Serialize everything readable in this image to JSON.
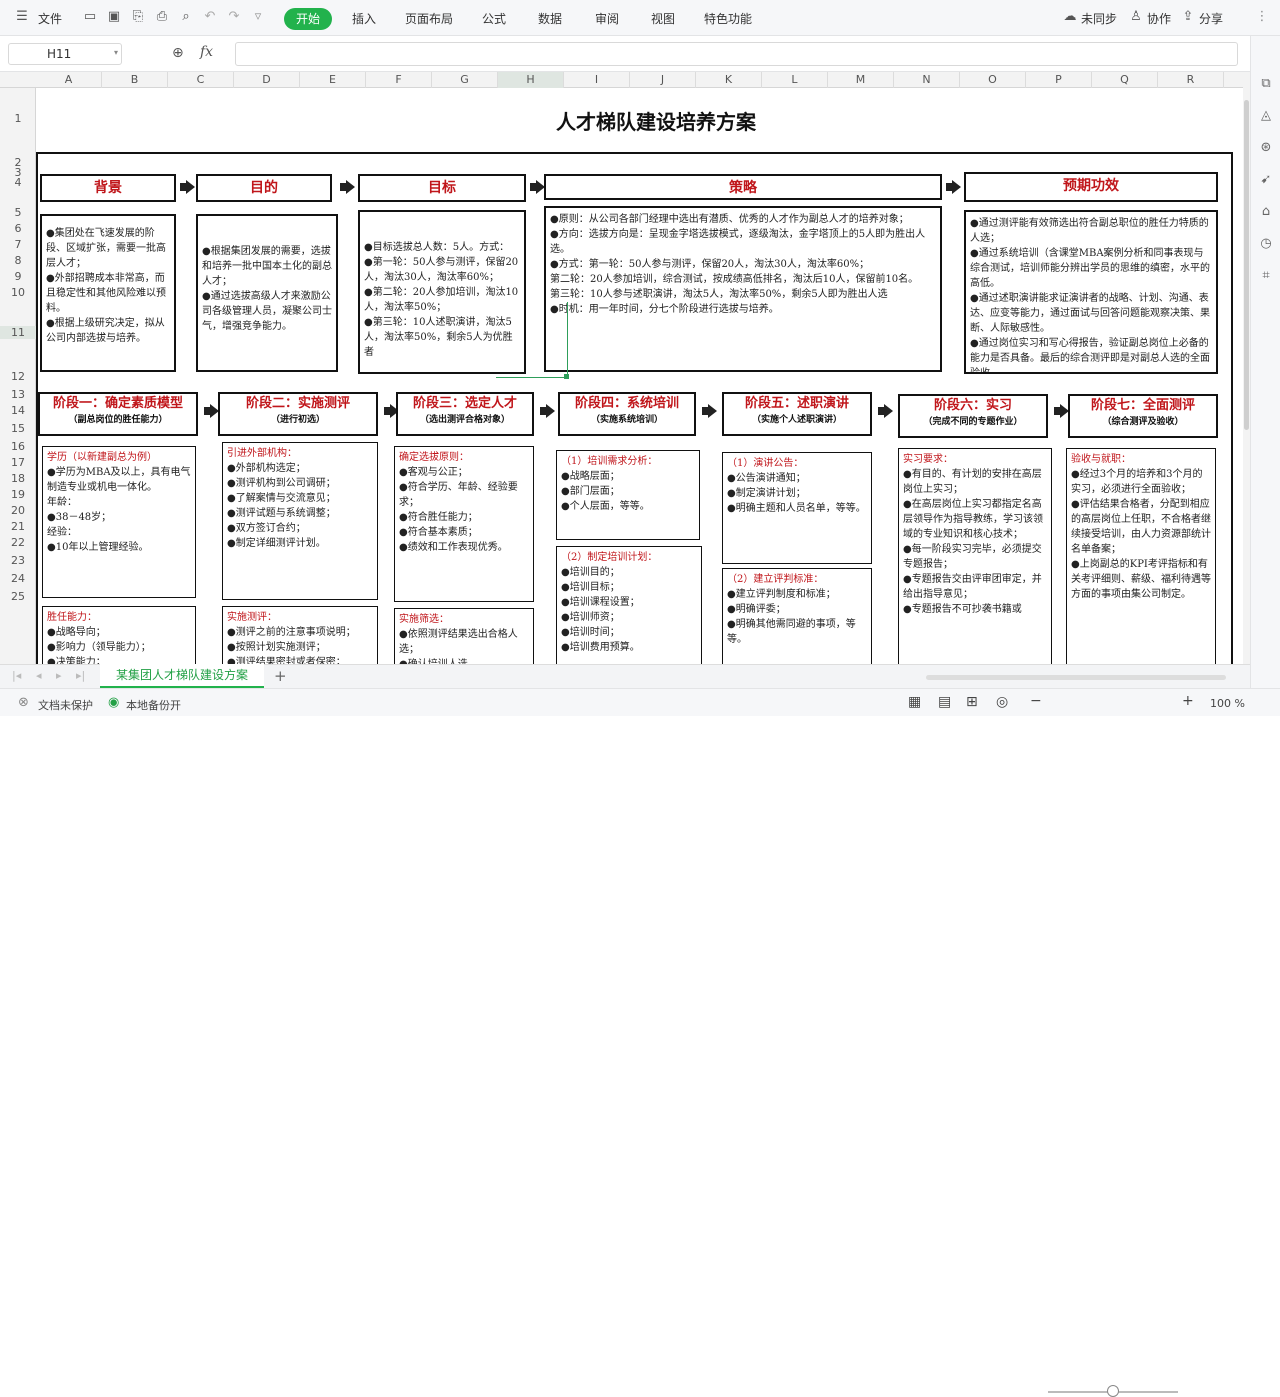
{
  "menu": {
    "file": "文件",
    "tabs": [
      "开始",
      "插入",
      "页面布局",
      "公式",
      "数据",
      "审阅",
      "视图",
      "特色功能"
    ],
    "sync": "未同步",
    "collab": "协作",
    "share": "分享"
  },
  "formula": {
    "cell": "H11",
    "fx": "fx",
    "content": ""
  },
  "columns": [
    "A",
    "B",
    "C",
    "D",
    "E",
    "F",
    "G",
    "H",
    "I",
    "J",
    "K",
    "L",
    "M",
    "N",
    "O",
    "P",
    "Q",
    "R"
  ],
  "rows": [
    "1",
    "2",
    "3",
    "4",
    "5",
    "6",
    "7",
    "8",
    "9",
    "10",
    "11",
    "12",
    "13",
    "14",
    "15",
    "16",
    "17",
    "18",
    "19",
    "20",
    "21",
    "22",
    "23",
    "24",
    "25"
  ],
  "doc": {
    "title": "人才梯队建设培养方案",
    "headers": [
      "背景",
      "目的",
      "目标",
      "策略",
      "预期功效"
    ],
    "bg": "●集团处在飞速发展的阶段、区域扩张，需要一批高层人才；\n●外部招聘成本非常高，而且稳定性和其他风险难以预料。\n●根据上级研究决定，拟从公司内部选拔与培养。",
    "purpose": "●根据集团发展的需要，选拔和培养一批中国本土化的副总人才；\n●通过选拔高级人才来激励公司各级管理人员，凝聚公司士气，增强竞争能力。",
    "goal": "●目标选拔总人数：5人。方式：\n●第一轮：50人参与测评，保留20人，淘汰30人，淘汰率60%；\n●第二轮：20人参加培训，淘汰10人，淘汰率50%；\n●第三轮：10人述职演讲，淘汰5人，淘汰率50%，剩余5人为优胜者",
    "strategy": "●原则：从公司各部门经理中选出有潜质、优秀的人才作为副总人才的培养对象；\n●方向：选拔方向是：呈现金字塔选拔模式，逐级淘汰，金字塔顶上的5人即为胜出人选。\n●方式：第一轮：50人参与测评，保留20人，淘汰30人，淘汰率60%；\n    第二轮：20人参加培训，综合测试，按成绩高低排名，淘汰后10人，保留前10名。\n    第三轮：10人参与述职演讲，淘汰5人，淘汰率50%，剩余5人即为胜出人选\n●时机：用一年时间，分七个阶段进行选拔与培养。",
    "effect": "●通过测评能有效筛选出符合副总职位的胜任力特质的人选；\n●通过系统培训（含课堂MBA案例分析和同事表现与综合测试，培训师能分辨出学员的思维的缜密，水平的高低。\n●通过述职演讲能求证演讲者的战略、计划、沟通、表达、应变等能力，通过面试与回答问题能观察决策、果断、人际敏感性。\n●通过岗位实习和写心得报告，验证副总岗位上必备的能力是否具备。最后的综合测评即是对副总人选的全面验收。",
    "phases": [
      {
        "t": "阶段一：确定素质模型",
        "s": "（副总岗位的胜任能力）"
      },
      {
        "t": "阶段二：实施测评",
        "s": "（进行初选）"
      },
      {
        "t": "阶段三：选定人才",
        "s": "（选出测评合格对象）"
      },
      {
        "t": "阶段四：系统培训",
        "s": "（实施系统培训）"
      },
      {
        "t": "阶段五：述职演讲",
        "s": "（实施个人述职演讲）"
      },
      {
        "t": "阶段六：实习",
        "s": "（完成不同的专题作业）"
      },
      {
        "t": "阶段七：全面测评",
        "s": "（综合测评及验收）"
      }
    ],
    "p1a_title": "学历（以新建副总为例）",
    "p1a": "●学历为MBA及以上，具有电气制造专业或机电一体化。\n年龄：\n●38－48岁；\n经验：\n●10年以上管理经验。",
    "p1b_title": "胜任能力：",
    "p1b": "●战略导向；\n●影响力（领导能力）；\n●决策能力；",
    "p2a_title": "引进外部机构：",
    "p2a": "●外部机构选定；\n●测评机构到公司调研；\n●了解案情与交流意见；\n●测评试题与系统调整；\n●双方签订合约；\n●制定详细测评计划。",
    "p2b_title": "实施测评：",
    "p2b": "●测评之前的注意事项说明；\n●按照计划实施测评；\n●测评结果密封或者保密；\n●公布测评最终结果",
    "p3a_title": "确定选拔原则：",
    "p3a": "●客观与公正；\n●符合学历、年龄、经验要求；\n●符合胜任能力；\n●符合基本素质；\n●绩效和工作表现优秀。",
    "p3b_title": "实施筛选：",
    "p3b": "●依照测评结果选出合格人选；\n●确认培训人选",
    "p4a_title": "（1）培训需求分析：",
    "p4a": "●战略层面；\n●部门层面；\n●个人层面，等等。",
    "p4b_title": "（2）制定培训计划：",
    "p4b": "●培训目的；\n●培训目标；\n●培训课程设置；\n●培训师资；\n●培训时间；\n●培训费用预算。",
    "p5a_title": "（1）演讲公告：",
    "p5a": "●公告演讲通知；\n●制定演讲计划；\n●明确主题和人员名单，等等。",
    "p5b_title": "（2）建立评判标准：",
    "p5b": "●建立评判制度和标准；\n●明确评委；\n●明确其他需同避的事项，等等。",
    "p6_title": "实习要求：",
    "p6": "●有目的、有计划的安排在高层岗位上实习；\n●在高层岗位上实习都指定名高层领导作为指导教练，学习该领域的专业知识和核心技术；\n●每一阶段实习完毕，必须提交专题报告；\n●专题报告交由评审团审定，并给出指导意见；\n●专题报告不可抄袭书籍或",
    "p7_title": "验收与就职：",
    "p7": "●经过3个月的培养和3个月的实习，必须进行全面验收；\n●评估结果合格者，分配到相应的高层岗位上任职，不合格者继续接受培训，由人力资源部统计名单备案；\n●上岗副总的KPI考评指标和有关考评细则、薪级、福利待遇等方面的事项由集公司制定。"
  },
  "sheet_tab": "某集团人才梯队建设方案",
  "status": {
    "protect": "文档未保护",
    "backup": "本地备份开",
    "zoom": "100 %",
    "zoom_level": 0.5
  }
}
